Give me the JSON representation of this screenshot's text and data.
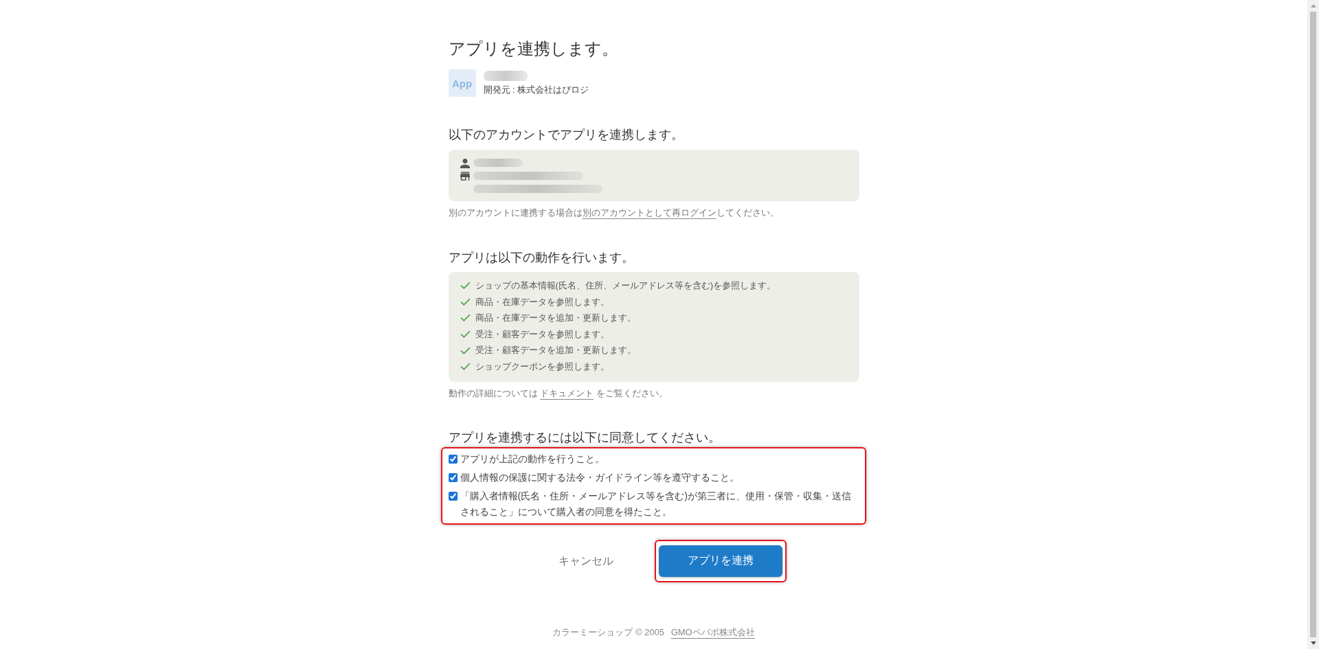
{
  "title": "アプリを連携します。",
  "app": {
    "logo_text": "App",
    "developer": "開発元 : 株式会社はぴロジ"
  },
  "account_section": {
    "heading": "以下のアカウントでアプリを連携します。",
    "rows": [
      {
        "kind": "user"
      },
      {
        "kind": "shop"
      }
    ],
    "note": {
      "before": "別のアカウントに連携する場合は",
      "link": "別のアカウントとして再ログイン",
      "after": "してください。"
    }
  },
  "permissions_section": {
    "heading": "アプリは以下の動作を行います。",
    "items": [
      "ショップの基本情報(氏名、住所、メールアドレス等を含む)を参照します。",
      "商品・在庫データを参照します。",
      "商品・在庫データを追加・更新します。",
      "受注・顧客データを参照します。",
      "受注・顧客データを追加・更新します。",
      "ショップクーポンを参照します。"
    ],
    "note": {
      "before": "動作の詳細については ",
      "link": "ドキュメント",
      "after": " をご覧ください。"
    }
  },
  "agreement_section": {
    "heading": "アプリを連携するには以下に同意してください。",
    "highlighted": true,
    "items": [
      {
        "text": "アプリが上記の動作を行うこと。",
        "checked": true
      },
      {
        "text": "個人情報の保護に関する法令・ガイドライン等を遵守すること。",
        "checked": true
      },
      {
        "text": "「購入者情報(氏名・住所・メールアドレス等を含む)が第三者に、使用・保管・収集・送信されること」について購入者の同意を得たこと。",
        "checked": true
      }
    ]
  },
  "buttons": [
    {
      "kind": "text",
      "label": "キャンセル",
      "highlighted": false
    },
    {
      "kind": "primary",
      "label": "アプリを連携",
      "highlighted": true
    }
  ],
  "footer": {
    "text": "カラーミーショップ © 2005",
    "link": "GMOペパボ株式会社"
  }
}
